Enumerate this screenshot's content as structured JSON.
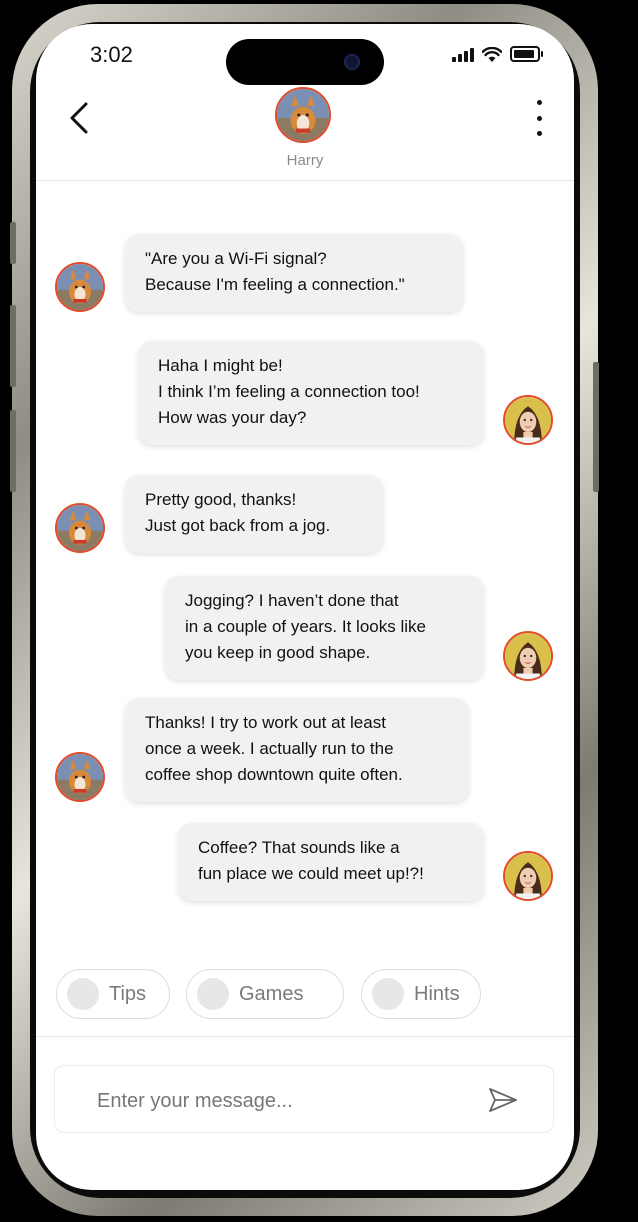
{
  "status_bar": {
    "time": "3:02"
  },
  "header": {
    "contact_name": "Harry"
  },
  "messages": [
    {
      "from": "contact",
      "text": "\"Are you a Wi-Fi signal?\nBecause I'm feeling a connection.\""
    },
    {
      "from": "me",
      "text": "Haha I might be!\nI think I’m feeling a connection too!\nHow was your day?"
    },
    {
      "from": "contact",
      "text": "Pretty good, thanks!\nJust got back from a jog."
    },
    {
      "from": "me",
      "text": "Jogging?  I haven’t done that\nin a couple of years.  It looks like\nyou keep in good shape."
    },
    {
      "from": "contact",
      "text": "Thanks!  I try to work out at least\nonce a week.  I actually run to the\ncoffee shop downtown quite often."
    },
    {
      "from": "me",
      "text": "Coffee?  That sounds like a\nfun place we could meet up!?!"
    }
  ],
  "chips": [
    {
      "label": "Tips"
    },
    {
      "label": "Games"
    },
    {
      "label": "Hints"
    }
  ],
  "composer": {
    "placeholder": "Enter your message..."
  },
  "colors": {
    "avatar_border": "#e24a2b",
    "bubble": "#f1f1f1",
    "chip_border": "#dcdcdc"
  }
}
